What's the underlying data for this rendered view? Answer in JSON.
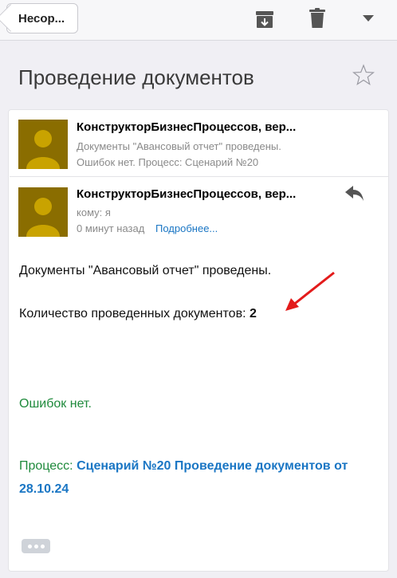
{
  "toolbar": {
    "back_label": "Несор...",
    "icons": [
      "archive-icon",
      "trash-icon",
      "dropdown-icon"
    ]
  },
  "message": {
    "subject": "Проведение документов"
  },
  "thread": [
    {
      "sender": "КонструкторБизнесПроцессов, вер...",
      "preview_line1": "Документы \"Авансовый отчет\" проведены.",
      "preview_line2": "Ошибок нет. Процесс: Сценарий №20"
    },
    {
      "sender": "КонструкторБизнесПроцессов, вер...",
      "to": "кому: я",
      "time": "0 минут назад",
      "details_link": "Подробнее..."
    }
  ],
  "body": {
    "line1": "Документы \"Авансовый отчет\" проведены.",
    "count_label": "Количество проведенных документов: ",
    "count_value": "2",
    "errors": "Ошибок нет.",
    "process_label": "Процесс: ",
    "process_link_line1": "Сценарий №20 Проведение документов от",
    "process_link_line2": "28.10.24"
  },
  "colors": {
    "avatar": "#8a6d00",
    "link": "#1a76c4",
    "green": "#1f8a3c",
    "annotation_arrow": "#e31b1b"
  }
}
